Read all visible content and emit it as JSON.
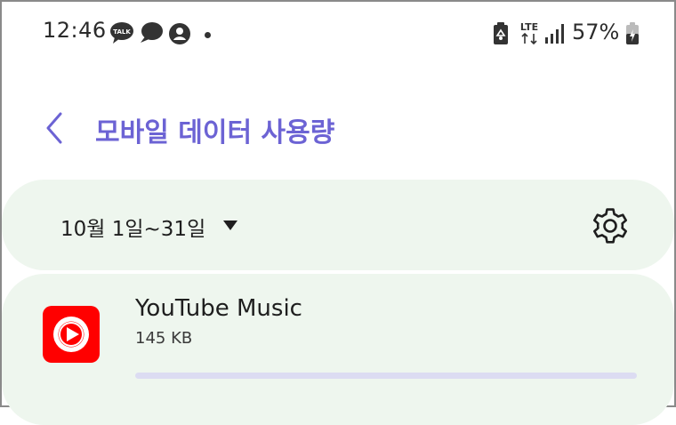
{
  "status_bar": {
    "time": "12:46",
    "network": "LTE",
    "battery": "57%",
    "icons": [
      "kakaotalk-icon",
      "chat-bubble-icon",
      "account-icon",
      "notification-dot",
      "battery-saver-icon",
      "lte-icon",
      "signal-icon",
      "battery-charging-icon"
    ]
  },
  "header": {
    "back_icon": "chevron-left-icon",
    "title": "모바일 데이터 사용량"
  },
  "filter": {
    "date_range": "10월 1일~31일",
    "dropdown_icon": "triangle-down-icon",
    "settings_icon": "gear-icon"
  },
  "apps": [
    {
      "name": "YouTube Music",
      "usage": "145 KB",
      "usage_fraction": 0.0,
      "icon": "youtube-music-icon"
    }
  ],
  "colors": {
    "accent": "#6c63d4",
    "card_bg": "#eef6ee",
    "bar_track": "#dcdcf2",
    "youtube_red": "#ff0000"
  }
}
